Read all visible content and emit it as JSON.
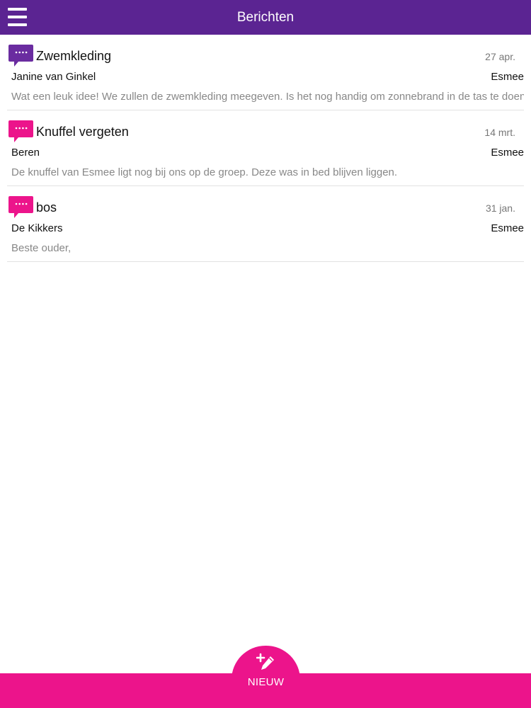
{
  "header": {
    "title": "Berichten",
    "menu_icon": "hamburger-menu-icon",
    "background_color": "#5b2492"
  },
  "messages": [
    {
      "title": "Zwemkleding",
      "date": "27 apr.",
      "sender": "Janine van Ginkel",
      "child": "Esmee",
      "preview": "Wat een leuk idee! We zullen de zwemkleding meegeven. Is het nog handig om zonnebrand in de tas te doen?",
      "icon": "chat-bubble-icon",
      "icon_color": "#6a2ca0"
    },
    {
      "title": "Knuffel vergeten",
      "date": "14 mrt.",
      "sender": "Beren",
      "child": "Esmee",
      "preview": "De knuffel van Esmee ligt nog bij ons op de groep. Deze was in bed blijven liggen.",
      "icon": "chat-bubble-icon",
      "icon_color": "#ec148b"
    },
    {
      "title": "bos",
      "date": "31 jan.",
      "sender": "De Kikkers",
      "child": "Esmee",
      "preview": "Beste ouder,",
      "icon": "chat-bubble-icon",
      "icon_color": "#ec148b"
    }
  ],
  "footer": {
    "new_label": "NIEUW",
    "new_icon": "compose-icon",
    "background_color": "#ec148b"
  }
}
